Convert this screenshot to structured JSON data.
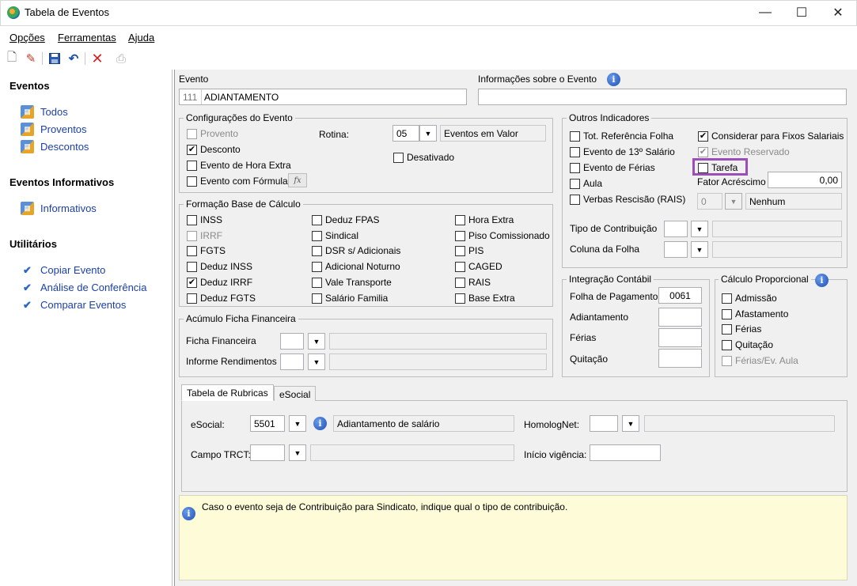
{
  "window": {
    "title": "Tabela de Eventos",
    "minimize": "—",
    "maximize": "☐",
    "close": "✕"
  },
  "menu": {
    "opcoes": "Opções",
    "ferramentas": "Ferramentas",
    "ajuda": "Ajuda"
  },
  "sidebar": {
    "eventos_title": "Eventos",
    "eventos": [
      "Todos",
      "Proventos",
      "Descontos"
    ],
    "informativos_title": "Eventos Informativos",
    "informativos": [
      "Informativos"
    ],
    "utilitarios_title": "Utilitários",
    "utilitarios": [
      "Copiar Evento",
      "Análise de Conferência",
      "Comparar Eventos"
    ]
  },
  "evento": {
    "label": "Evento",
    "code": "111",
    "name": "ADIANTAMENTO",
    "info_label": "Informações sobre o Evento",
    "info_value": ""
  },
  "config": {
    "title": "Configurações do Evento",
    "provento": "Provento",
    "desconto": "Desconto",
    "hora_extra": "Evento de Hora Extra",
    "formula": "Evento com Fórmula",
    "fx": "fx",
    "rotina_label": "Rotina:",
    "rotina_value": "05",
    "rotina_desc": "Eventos em Valor",
    "desativado": "Desativado"
  },
  "formacao": {
    "title": "Formação Base de Cálculo",
    "col1": [
      "INSS",
      "IRRF",
      "FGTS",
      "Deduz INSS",
      "Deduz IRRF",
      "Deduz FGTS"
    ],
    "col2": [
      "Deduz FPAS",
      "Sindical",
      "DSR s/ Adicionais",
      "Adicional Noturno",
      "Vale Transporte",
      "Salário Familia"
    ],
    "col3": [
      "Hora Extra",
      "Piso Comissionado",
      "PIS",
      "CAGED",
      "RAIS",
      "Base Extra"
    ]
  },
  "acumulo": {
    "title": "Acúmulo Ficha Financeira",
    "ficha": "Ficha Financeira",
    "informe": "Informe Rendimentos"
  },
  "outros": {
    "title": "Outros Indicadores",
    "tot_ref": "Tot. Referência Folha",
    "evento_13": "Evento de 13º Salário",
    "evento_ferias": "Evento de Férias",
    "aula": "Aula",
    "verbas": "Verbas Rescisão (RAIS)",
    "considerar": "Considerar para Fixos Salariais",
    "reservado": "Evento Reservado",
    "tarefa": "Tarefa",
    "fator_label": "Fator Acréscimo",
    "fator_value": "0,00",
    "verbas_value": "0",
    "verbas_desc": "Nenhum",
    "tipo_contrib": "Tipo de Contribuição",
    "coluna_folha": "Coluna da Folha"
  },
  "integracao": {
    "title": "Integração Contábil",
    "folha": "Folha de Pagamento",
    "folha_value": "0061",
    "adiantamento": "Adiantamento",
    "ferias": "Férias",
    "quitacao": "Quitação"
  },
  "proporcional": {
    "title": "Cálculo Proporcional",
    "items": [
      "Admissão",
      "Afastamento",
      "Férias",
      "Quitação",
      "Férias/Ev. Aula"
    ]
  },
  "tabs": {
    "rubricas": "Tabela de Rubricas",
    "esocial": "eSocial"
  },
  "rubricas": {
    "esocial_label": "eSocial:",
    "esocial_value": "5501",
    "esocial_desc": "Adiantamento de salário",
    "homolog_label": "HomologNet:",
    "trct_label": "Campo TRCT:",
    "inicio_label": "Início vigência:"
  },
  "hint": {
    "text": "Caso o evento seja de Contribuição para Sindicato, indique qual o tipo de contribuição."
  },
  "colors": {
    "link": "#1a3fa8",
    "highlight": "#9b4fb6",
    "hint_bg": "#fdfbd8"
  }
}
